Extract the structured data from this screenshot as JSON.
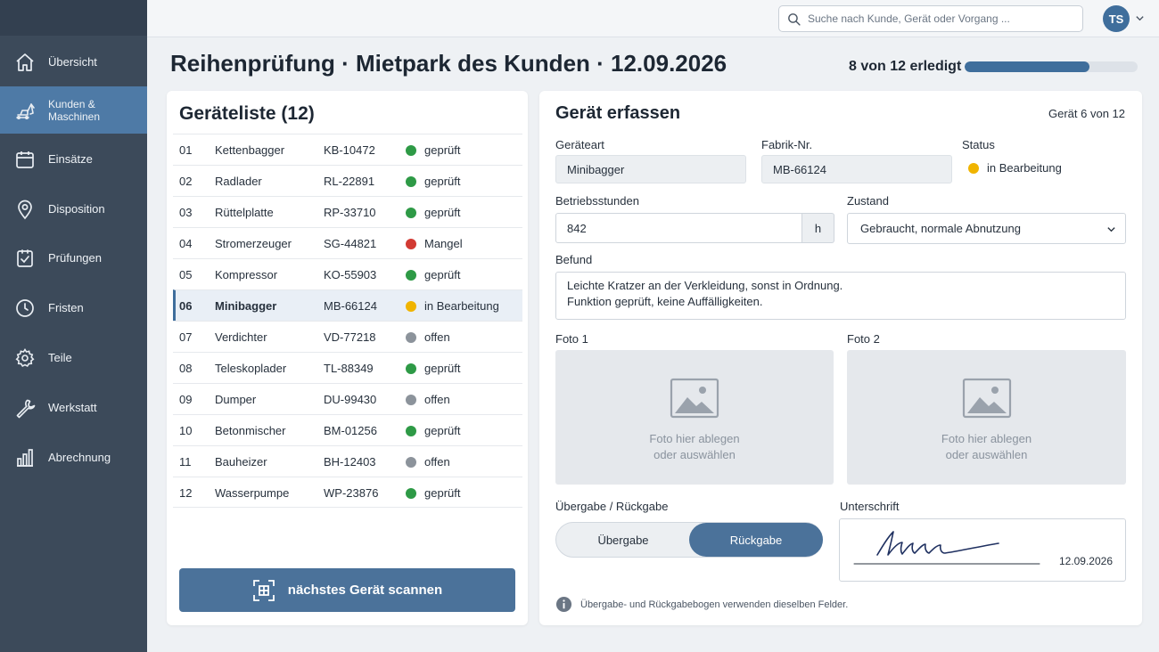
{
  "sidebar": {
    "items": [
      {
        "label": "Übersicht",
        "icon": "home-icon"
      },
      {
        "label": "Kunden & Maschinen",
        "icon": "excavator-icon",
        "active": true
      },
      {
        "label": "Einsätze",
        "icon": "calendar-icon"
      },
      {
        "label": "Disposition",
        "icon": "location-pin-icon"
      },
      {
        "label": "Prüfungen",
        "icon": "checklist-icon"
      },
      {
        "label": "Fristen",
        "icon": "clock-icon"
      },
      {
        "label": "Teile",
        "icon": "gear-icon"
      },
      {
        "label": "Werkstatt",
        "icon": "wrench-icon"
      },
      {
        "label": "Abrechnung",
        "icon": "bar-chart-icon"
      }
    ]
  },
  "topbar": {
    "search_placeholder": "Suche nach Kunde, Gerät oder Vorgang ...",
    "user_initials": "TS"
  },
  "header": {
    "title": "Reihenprüfung · Mietpark des Kunden · 12.09.2026",
    "progress_text": "8 von 12 erledigt",
    "progress_fraction": 0.72
  },
  "list": {
    "title": "Geräteliste (12)",
    "rows": [
      {
        "num": "01",
        "name": "Kettenbagger",
        "id": "KB-10472",
        "status": "geprüft",
        "color": "#2e9a46"
      },
      {
        "num": "02",
        "name": "Radlader",
        "id": "RL-22891",
        "status": "geprüft",
        "color": "#2e9a46"
      },
      {
        "num": "03",
        "name": "Rüttelplatte",
        "id": "RP-33710",
        "status": "geprüft",
        "color": "#2e9a46"
      },
      {
        "num": "04",
        "name": "Stromerzeuger",
        "id": "SG-44821",
        "status": "Mangel",
        "color": "#d23a33"
      },
      {
        "num": "05",
        "name": "Kompressor",
        "id": "KO-55903",
        "status": "geprüft",
        "color": "#2e9a46"
      },
      {
        "num": "06",
        "name": "Minibagger",
        "id": "MB-66124",
        "status": "in Bearbeitung",
        "color": "#f0b400",
        "selected": true
      },
      {
        "num": "07",
        "name": "Verdichter",
        "id": "VD-77218",
        "status": "offen",
        "color": "#8c939b"
      },
      {
        "num": "08",
        "name": "Teleskoplader",
        "id": "TL-88349",
        "status": "geprüft",
        "color": "#2e9a46"
      },
      {
        "num": "09",
        "name": "Dumper",
        "id": "DU-99430",
        "status": "offen",
        "color": "#8c939b"
      },
      {
        "num": "10",
        "name": "Betonmischer",
        "id": "BM-01256",
        "status": "geprüft",
        "color": "#2e9a46"
      },
      {
        "num": "11",
        "name": "Bauheizer",
        "id": "BH-12403",
        "status": "offen",
        "color": "#8c939b"
      },
      {
        "num": "12",
        "name": "Wasserpumpe",
        "id": "WP-23876",
        "status": "geprüft",
        "color": "#2e9a46"
      }
    ],
    "scan_button": "nächstes Gerät scannen"
  },
  "form": {
    "title": "Gerät erfassen",
    "counter": "Gerät 6 von 12",
    "geraeteart_label": "Geräteart",
    "geraeteart_value": "Minibagger",
    "fabrik_label": "Fabrik-Nr.",
    "fabrik_value": "MB-66124",
    "status_label": "Status",
    "status_value": "in Bearbeitung",
    "status_color": "#f0b400",
    "hours_label": "Betriebsstunden",
    "hours_value": "842",
    "hours_unit": "h",
    "zustand_label": "Zustand",
    "zustand_value": "Gebraucht, normale Abnutzung",
    "befund_label": "Befund",
    "befund_line1": "Leichte Kratzer an der Verkleidung, sonst in Ordnung.",
    "befund_line2": "Funktion geprüft, keine Auffälligkeiten.",
    "foto1_label": "Foto 1",
    "foto2_label": "Foto 2",
    "dropzone_line1": "Foto hier ablegen",
    "dropzone_line2": "oder auswählen",
    "toggle_label": "Übergabe / Rückgabe",
    "toggle_left": "Übergabe",
    "toggle_right": "Rückgabe",
    "signature_label": "Unterschrift",
    "signature_date": "12.09.2026",
    "info_text": "Übergabe- und Rückgabebogen verwenden dieselben Felder."
  },
  "colors": {
    "sidebar_bg": "#3c4a5a",
    "accent": "#4b729a",
    "ok": "#2e9a46",
    "defect": "#d23a33",
    "in_progress": "#f0b400",
    "open": "#8c939b"
  }
}
